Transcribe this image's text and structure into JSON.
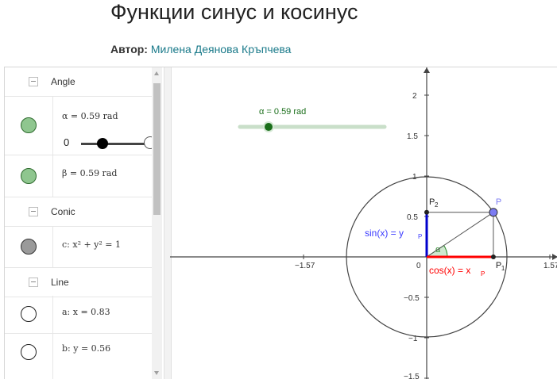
{
  "page": {
    "title": "Функции синус и косинус",
    "author_label": "Автор:",
    "author_name": "Милена Деянова Кръпчева"
  },
  "algebra": {
    "groups": [
      {
        "label": "Angle"
      },
      {
        "label": "Conic"
      },
      {
        "label": "Line"
      }
    ],
    "items": [
      {
        "expr": "α = 0.59 rad",
        "color": "#8fc68f",
        "filled": true
      },
      {
        "expr": "β = 0.59 rad",
        "color": "#8fc68f",
        "filled": true
      },
      {
        "expr": "c: x² + y² = 1",
        "color": "#9a9a9a",
        "filled": true
      },
      {
        "expr": "a: x = 0.83",
        "color": "#ffffff",
        "filled": false
      },
      {
        "expr": "b: y = 0.56",
        "color": "#ffffff",
        "filled": false
      }
    ],
    "slider_min": "0"
  },
  "graphics": {
    "slider_label": "α = 0.59 rad",
    "alpha": 0.59,
    "x_ticks": [
      "−1.57",
      "0",
      "1.57"
    ],
    "y_ticks": [
      "2",
      "1.5",
      "1",
      "0.5",
      "−0.5",
      "−1",
      "−1.5"
    ],
    "point_labels": {
      "p": "P",
      "p1": "P",
      "p1_sub": "1",
      "p2": "P",
      "p2_sub": "2",
      "alpha": "α"
    },
    "sin_label": "sin(x) = y",
    "sin_sub": "P",
    "cos_label": "cos(x) = x",
    "cos_sub": "P",
    "colors": {
      "sin": "#0000cc",
      "cos": "#ff0000",
      "point": "#7b7bf2",
      "slider": "#1a6e1a",
      "angle": "#2e8b2e",
      "sin_label": "#3a3aff"
    }
  }
}
